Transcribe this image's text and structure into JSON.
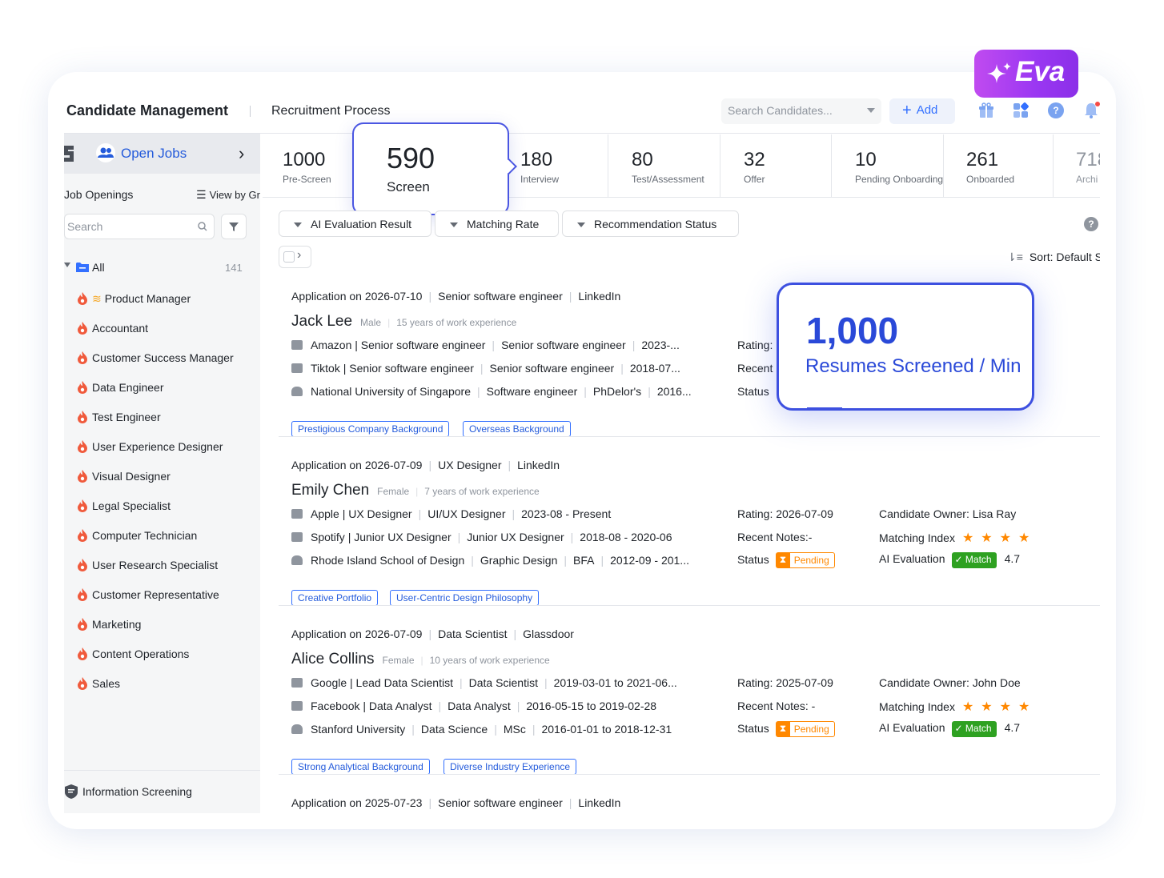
{
  "header": {
    "title": "Candidate Management",
    "subtitle": "Recruitment Process",
    "search_placeholder": "Search Candidates...",
    "add_label": "Add"
  },
  "eva": {
    "label": "Eva"
  },
  "sidebar": {
    "open_jobs": "Open Jobs",
    "job_openings": "Job Openings",
    "view_by": "View by Gr",
    "search_placeholder": "Search",
    "all_label": "All",
    "all_count": "141",
    "jobs": [
      "Product Manager",
      "Accountant",
      "Customer Success Manager",
      "Data Engineer",
      "Test Engineer",
      "User Experience Designer",
      "Visual Designer",
      "Legal Specialist",
      "Computer Technician",
      "User Research Specialist",
      "Customer Representative",
      "Marketing",
      "Content Operations",
      "Sales"
    ],
    "info_screening": "Information Screening"
  },
  "stages": [
    {
      "num": "1000",
      "label": "Pre-Screen"
    },
    {
      "num": "590",
      "label": "Screen"
    },
    {
      "num": "180",
      "label": "Interview"
    },
    {
      "num": "80",
      "label": "Test/Assessment"
    },
    {
      "num": "32",
      "label": "Offer"
    },
    {
      "num": "10",
      "label": "Pending Onboarding"
    },
    {
      "num": "261",
      "label": "Onboarded"
    },
    {
      "num": "718",
      "label": "Archi"
    }
  ],
  "filters": {
    "chips": [
      "AI Evaluation Result",
      "Matching Rate",
      "Recommendation Status"
    ],
    "sort_label": "Sort: Default S"
  },
  "callout": {
    "big": "1,000",
    "sub": "Resumes Screened / Min"
  },
  "candidates": [
    {
      "meta": [
        "Application on 2026-07-10",
        "Senior software engineer",
        "LinkedIn"
      ],
      "name": "Jack Lee",
      "gender": "Male",
      "experience": "15 years of work experience",
      "lines": [
        [
          "Amazon | Senior software engineer",
          "Senior software engineer",
          "2023-..."
        ],
        [
          "Tiktok | Senior software engineer",
          "Senior software engineer",
          "2018-07..."
        ],
        [
          "National University of Singapore",
          "Software engineer",
          "PhDelor's",
          "2016..."
        ]
      ],
      "tags": [
        "Prestigious Company Background",
        "Overseas Background"
      ],
      "rating": "Rating:",
      "recent": "Recent",
      "status": "Status"
    },
    {
      "meta": [
        "Application on 2026-07-09",
        "UX Designer",
        "LinkedIn"
      ],
      "name": "Emily Chen",
      "gender": "Female",
      "experience": "7 years of work experience",
      "lines": [
        [
          "Apple | UX Designer",
          "UI/UX Designer",
          "2023-08 -  Present"
        ],
        [
          "Spotify | Junior UX Designer",
          "Junior UX Designer",
          "2018-08 - 2020-06"
        ],
        [
          "Rhode Island School of Design",
          "Graphic Design",
          "BFA",
          "2012-09 - 201..."
        ]
      ],
      "tags": [
        "Creative Portfolio",
        "User-Centric Design Philosophy"
      ],
      "rating": "Rating: 2026-07-09",
      "recent": "Recent Notes:-",
      "status": "Status",
      "status_badge": "Pending",
      "owner": "Candidate Owner: Lisa Ray",
      "matching": "Matching Index",
      "stars": 4,
      "ai_eval": "AI Evaluation",
      "match_badge": "Match",
      "score": "4.7"
    },
    {
      "meta": [
        "Application on 2026-07-09",
        "Data Scientist",
        "Glassdoor"
      ],
      "name": "Alice Collins",
      "gender": "Female",
      "experience": "10 years of work experience",
      "lines": [
        [
          "Google | Lead Data Scientist",
          "Data Scientist",
          "2019-03-01 to 2021-06..."
        ],
        [
          "Facebook | Data Analyst",
          "Data Analyst",
          "2016-05-15 to 2019-02-28"
        ],
        [
          "Stanford University",
          "Data Science",
          "MSc",
          "2016-01-01 to 2018-12-31"
        ]
      ],
      "tags": [
        "Strong Analytical Background",
        "Diverse Industry Experience"
      ],
      "rating": "Rating: 2025-07-09",
      "recent": "Recent Notes: -",
      "status": "Status",
      "status_badge": "Pending",
      "owner": "Candidate Owner: John Doe",
      "matching": "Matching Index",
      "stars": 4,
      "ai_eval": "AI Evaluation",
      "match_badge": "Match",
      "score": "4.7"
    },
    {
      "meta": [
        "Application on 2025-07-23",
        "Senior software engineer",
        "LinkedIn"
      ]
    }
  ],
  "colors": {
    "accent": "#3370ff",
    "callout": "#2a49d8",
    "pending": "#ff8800",
    "match": "#2ea121",
    "flame": "#f05a3c",
    "eva_gradient_start": "#c04bf0",
    "eva_gradient_end": "#8b2fe8"
  }
}
